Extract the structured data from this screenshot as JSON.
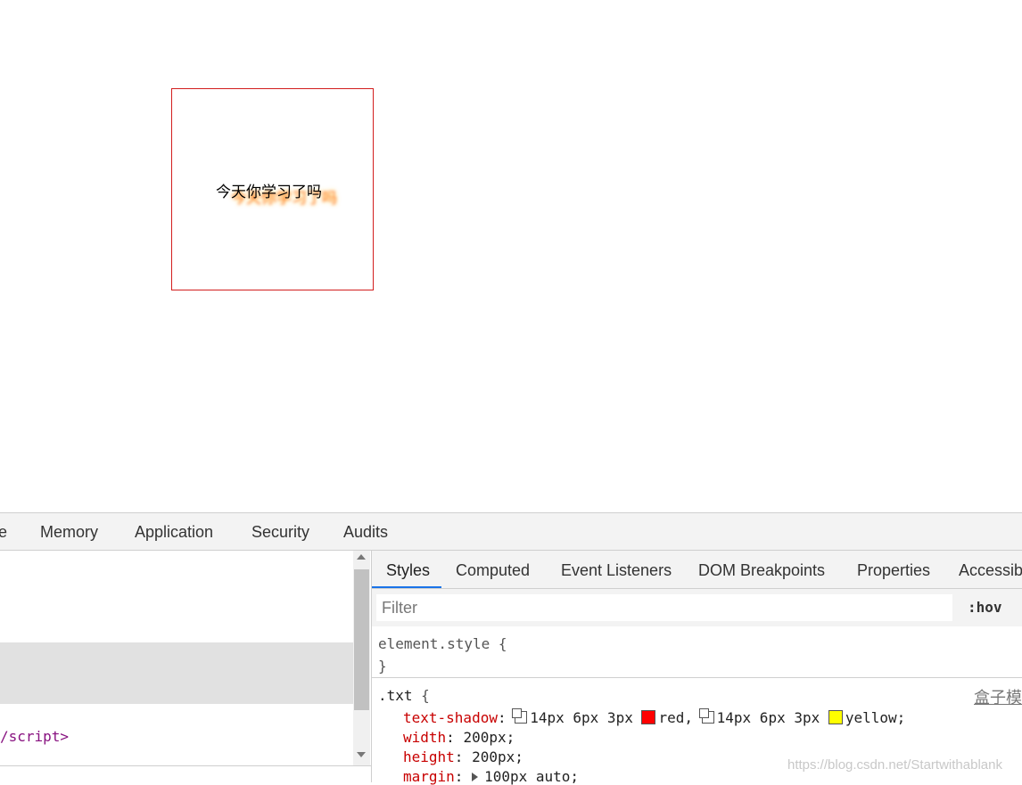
{
  "demo": {
    "text": "今天你学习了吗"
  },
  "devtools": {
    "main_tabs": [
      "e",
      "Memory",
      "Application",
      "Security",
      "Audits"
    ],
    "elements": {
      "closing_tag": "/script>"
    },
    "sidebar_tabs": [
      "Styles",
      "Computed",
      "Event Listeners",
      "DOM Breakpoints",
      "Properties",
      "Accessib"
    ],
    "active_sidebar_tab": "Styles",
    "filter": {
      "placeholder": "Filter",
      "value": ""
    },
    "hov_label": ":hov",
    "element_style": {
      "selector": "element.style",
      "open": "{",
      "close": "}"
    },
    "rule": {
      "selector": ".txt",
      "open": "{",
      "source": "盒子模",
      "text_shadow": {
        "property": "text-shadow",
        "part1": "14px 6px 3px",
        "color1_name": "red,",
        "color1": "#ff0000",
        "part2": "14px 6px 3px",
        "color2_name": "yellow;",
        "color2": "#ffff00"
      },
      "width": {
        "property": "width",
        "value": "200px;"
      },
      "height": {
        "property": "height",
        "value": "200px;"
      },
      "margin": {
        "property": "margin",
        "value": "100px auto;"
      }
    }
  },
  "watermark": "https://blog.csdn.net/Startwithablank",
  "colors": {
    "accent": "#1a73e8",
    "border_red": "#d21e1e",
    "property": "#c80000",
    "tag": "#881280"
  }
}
